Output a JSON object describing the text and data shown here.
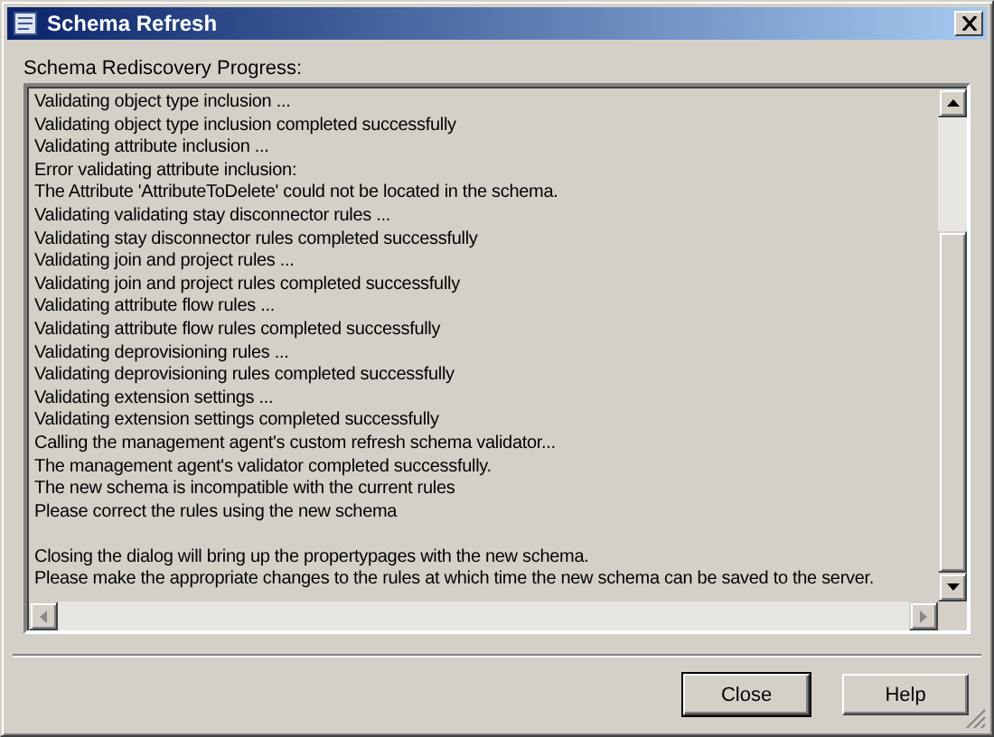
{
  "window": {
    "title": "Schema Refresh"
  },
  "progress_label": "Schema Rediscovery Progress:",
  "log": [
    {
      "lines": [
        "Validating object type inclusion ...",
        "Validating object type inclusion completed successfully",
        "Validating attribute inclusion ...",
        "Error validating attribute inclusion:",
        "The Attribute 'AttributeToDelete' could not be located in the schema.",
        "Validating validating stay disconnector rules ...",
        "Validating stay disconnector rules completed successfully",
        "Validating join and project rules ...",
        "Validating join and project rules completed successfully",
        "Validating attribute flow rules ...",
        "Validating attribute flow rules completed successfully",
        "Validating deprovisioning rules ...",
        "Validating deprovisioning rules completed successfully",
        "Validating extension settings ...",
        "Validating extension settings completed successfully",
        "Calling the management agent's custom refresh schema validator...",
        "The management agent's validator completed successfully.",
        "The new schema is incompatible with the current rules",
        "Please correct the rules using the new schema"
      ]
    },
    {
      "lines": [
        "Closing the dialog will bring up the propertypages with the new schema.",
        "Please make the appropriate changes to the rules at which time the new schema can be saved to the server."
      ]
    }
  ],
  "buttons": [
    {
      "label": "Close",
      "default": true
    },
    {
      "label": "Help",
      "default": false
    }
  ]
}
